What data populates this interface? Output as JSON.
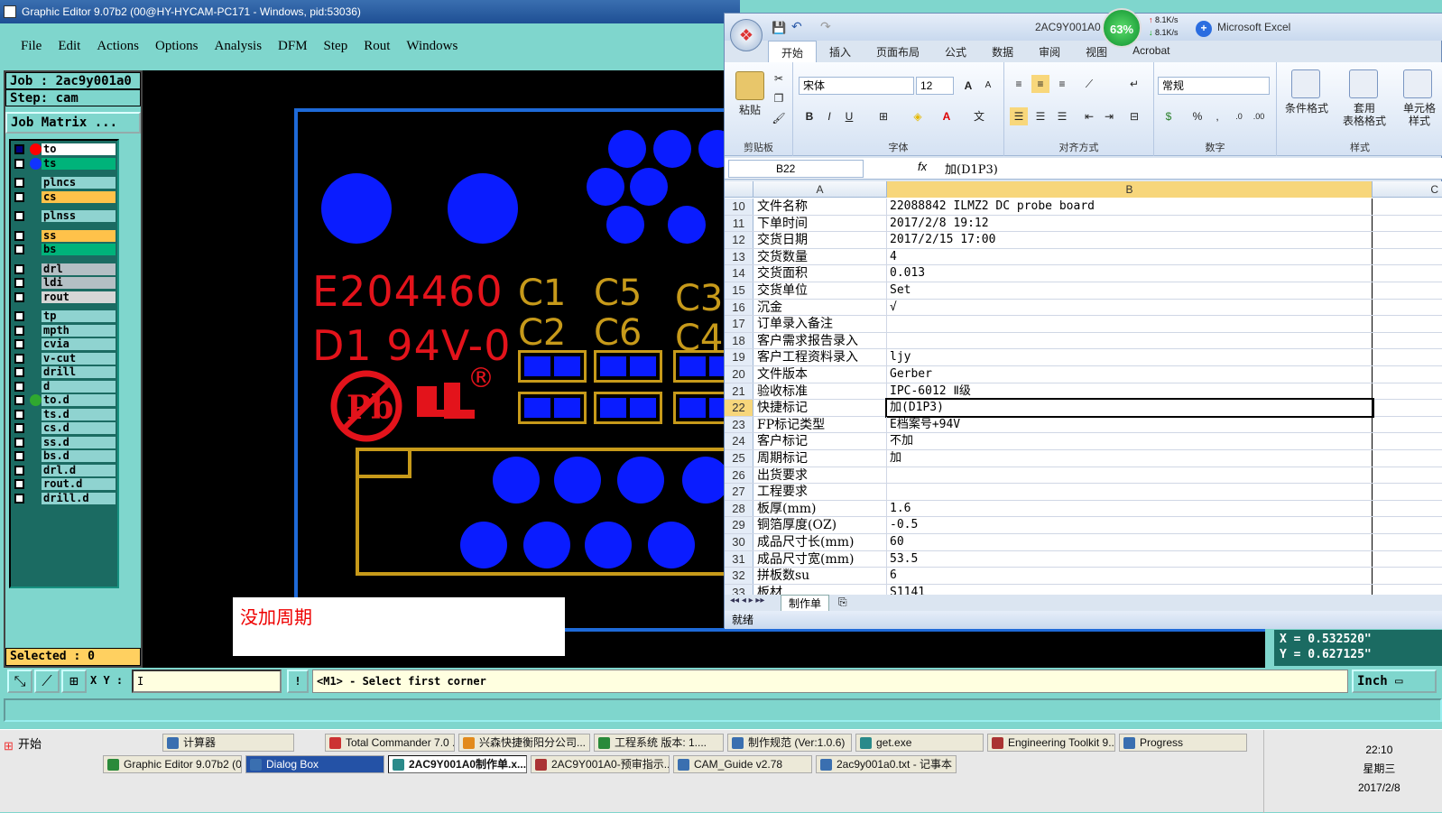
{
  "genesis": {
    "title": "Graphic Editor 9.07b2 (00@HY-HYCAM-PC171 - Windows, pid:53036)",
    "menu": [
      "File",
      "Edit",
      "Actions",
      "Options",
      "Analysis",
      "DFM",
      "Step",
      "Rout",
      "Windows"
    ],
    "job": "Job : 2ac9y001a0",
    "step": "Step: cam",
    "job_matrix": "Job Matrix ...",
    "layers": [
      {
        "name": "to",
        "color": "#ffffff",
        "dot": "#ff0000",
        "pre": "#000080"
      },
      {
        "name": "ts",
        "color": "#00b37a",
        "dot": "#1133ff",
        "pre": ""
      },
      {
        "name": "plncs",
        "color": "#8fd3d0",
        "dot": "",
        "pre": ""
      },
      {
        "name": "cs",
        "color": "#ffc24a",
        "dot": "",
        "pre": ""
      },
      {
        "name": "plnss",
        "color": "#8fd3d0",
        "dot": "",
        "pre": ""
      },
      {
        "name": "ss",
        "color": "#ffc24a",
        "dot": "",
        "pre": ""
      },
      {
        "name": "bs",
        "color": "#00b37a",
        "dot": "",
        "pre": ""
      },
      {
        "name": "drl",
        "color": "#b4bfc4",
        "dot": "",
        "pre": ""
      },
      {
        "name": "ldi",
        "color": "#b4bfc4",
        "dot": "",
        "pre": ""
      },
      {
        "name": "rout",
        "color": "#d6d6d6",
        "dot": "",
        "pre": ""
      },
      {
        "name": "tp",
        "color": "#8fd3d0",
        "dot": "",
        "pre": ""
      },
      {
        "name": "mpth",
        "color": "#8fd3d0",
        "dot": "",
        "pre": ""
      },
      {
        "name": "cvia",
        "color": "#8fd3d0",
        "dot": "",
        "pre": ""
      },
      {
        "name": "v-cut",
        "color": "#8fd3d0",
        "dot": "",
        "pre": ""
      },
      {
        "name": "drill",
        "color": "#8fd3d0",
        "dot": "",
        "pre": ""
      },
      {
        "name": "d",
        "color": "#8fd3d0",
        "dot": "",
        "pre": ""
      },
      {
        "name": "to.d",
        "color": "#8fd3d0",
        "dot": "#2fa82f",
        "pre": ""
      },
      {
        "name": "ts.d",
        "color": "#8fd3d0",
        "dot": "",
        "pre": ""
      },
      {
        "name": "cs.d",
        "color": "#8fd3d0",
        "dot": "",
        "pre": ""
      },
      {
        "name": "ss.d",
        "color": "#8fd3d0",
        "dot": "",
        "pre": ""
      },
      {
        "name": "bs.d",
        "color": "#8fd3d0",
        "dot": "",
        "pre": ""
      },
      {
        "name": "drl.d",
        "color": "#8fd3d0",
        "dot": "",
        "pre": ""
      },
      {
        "name": "rout.d",
        "color": "#8fd3d0",
        "dot": "",
        "pre": ""
      },
      {
        "name": "drill.d",
        "color": "#8fd3d0",
        "dot": "",
        "pre": ""
      }
    ],
    "selected": "Selected : 0",
    "pcb_text": {
      "ul": "E204460",
      "d1": "D1  94V-0",
      "c1": "C1",
      "c5": "C5",
      "c3": "C3",
      "c2": "C2",
      "c6": "C6",
      "c4": "C4",
      "reg": "®"
    },
    "note": "没加周期",
    "xy_label": "X Y :",
    "xy_value": "I",
    "excl": "!",
    "prompt": "<M1> - Select first corner",
    "units": "Inch",
    "coord_x": "X = 0.532520\"",
    "coord_y": "Y = 0.627125\""
  },
  "excel": {
    "doc_title": "2AC9Y001A0",
    "app": "Microsoft Excel",
    "net": {
      "pct": "63%",
      "up": "8.1K/s",
      "down": "8.1K/s"
    },
    "tabs": [
      "开始",
      "插入",
      "页面布局",
      "公式",
      "数据",
      "审阅",
      "视图",
      "Acrobat"
    ],
    "ribbon": {
      "paste": "粘贴",
      "clipboard": "剪贴板",
      "font_name": "宋体",
      "font_size": "12",
      "font_group": "字体",
      "align_group": "对齐方式",
      "number_fmt": "常规",
      "number_group": "数字",
      "cond_fmt": "条件格式",
      "table_fmt": "套用\n表格格式",
      "cell_style": "单元格\n样式",
      "style_group": "样式"
    },
    "name_box": "B22",
    "fx": "fx",
    "formula": "加(D1P3)",
    "cols": [
      "A",
      "B",
      "C"
    ],
    "rows": [
      {
        "n": "10",
        "a": "文件名称",
        "b": "22088842 ILMZ2 DC probe board"
      },
      {
        "n": "11",
        "a": "下单时间",
        "b": "2017/2/8 19:12"
      },
      {
        "n": "12",
        "a": "交货日期",
        "b": "2017/2/15 17:00"
      },
      {
        "n": "13",
        "a": "交货数量",
        "b": "4"
      },
      {
        "n": "14",
        "a": "交货面积",
        "b": "0.013"
      },
      {
        "n": "15",
        "a": "交货单位",
        "b": "Set"
      },
      {
        "n": "16",
        "a": "沉金",
        "b": "√"
      },
      {
        "n": "17",
        "a": "订单录入备注",
        "b": ""
      },
      {
        "n": "18",
        "a": "客户需求报告录入",
        "b": ""
      },
      {
        "n": "19",
        "a": "客户工程资料录入",
        "b": "ljy"
      },
      {
        "n": "20",
        "a": "文件版本",
        "b": "Gerber"
      },
      {
        "n": "21",
        "a": "验收标准",
        "b": "IPC-6012 Ⅱ级"
      },
      {
        "n": "22",
        "a": "快捷标记",
        "b": "加(D1P3)"
      },
      {
        "n": "23",
        "a": "FP标记类型",
        "b": "E档案号+94V"
      },
      {
        "n": "24",
        "a": "客户标记",
        "b": "不加"
      },
      {
        "n": "25",
        "a": "周期标记",
        "b": "加"
      },
      {
        "n": "26",
        "a": "出货要求",
        "b": ""
      },
      {
        "n": "27",
        "a": "工程要求",
        "b": ""
      },
      {
        "n": "28",
        "a": "板厚(mm)",
        "b": "1.6"
      },
      {
        "n": "29",
        "a": "铜箔厚度(OZ)",
        "b": "-0.5"
      },
      {
        "n": "30",
        "a": "成品尺寸长(mm)",
        "b": "60"
      },
      {
        "n": "31",
        "a": "成品尺寸宽(mm)",
        "b": "53.5"
      },
      {
        "n": "32",
        "a": "拼板数su",
        "b": "6"
      },
      {
        "n": "33",
        "a": "板材",
        "b": "S1141"
      }
    ],
    "sheet_tab": "制作单",
    "status": "就绪"
  },
  "taskbar": {
    "start": "开始",
    "row1": [
      "计算器",
      "Total Commander 7.0 ...",
      "兴森快捷衡阳分公司...",
      "工程系统  版本: 1....",
      "制作规范 (Ver:1.0.6)",
      "get.exe",
      "Engineering Toolkit 9....",
      "Progress"
    ],
    "row2": [
      "Graphic Editor 9.07b2 (0...",
      "Dialog Box",
      "2AC9Y001A0制作单.x...",
      "2AC9Y001A0-预审指示...",
      "CAM_Guide v2.78",
      "2ac9y001a0.txt - 记事本"
    ],
    "time": "22:10",
    "weekday": "星期三",
    "date": "2017/2/8"
  }
}
